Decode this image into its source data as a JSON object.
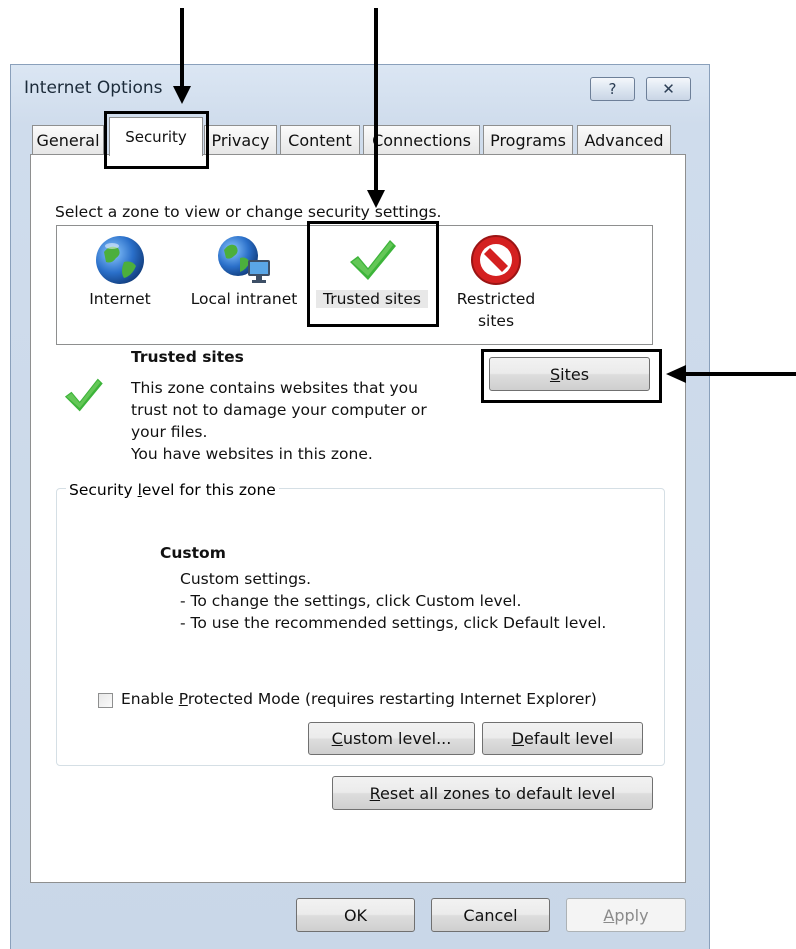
{
  "dialog": {
    "title": "Internet Options",
    "help_glyph": "?",
    "close_glyph": "✕"
  },
  "tabs": [
    "General",
    "Security",
    "Privacy",
    "Content",
    "Connections",
    "Programs",
    "Advanced"
  ],
  "security": {
    "zone_prompt": "Select a zone to view or change security settings.",
    "zones": [
      {
        "label": "Internet",
        "icon": "globe-icon"
      },
      {
        "label": "Local intranet",
        "icon": "globe-network-icon"
      },
      {
        "label": "Trusted sites",
        "icon": "checkmark-icon"
      },
      {
        "label_line1": "Restricted",
        "label_line2": "sites",
        "icon": "no-entry-icon"
      }
    ],
    "selected_zone": {
      "title": "Trusted sites",
      "desc1": "This zone contains websites that you",
      "desc2": "trust not to damage your computer or",
      "desc3": "your files.",
      "desc4": "You have websites in this zone."
    },
    "sites_button": {
      "mnemonic": "S",
      "rest": "ites"
    },
    "level_group": {
      "pre": "Security ",
      "mnemonic": "l",
      "post": "evel for this zone"
    },
    "custom": {
      "title": "Custom",
      "line1": "Custom settings.",
      "line2": "- To change the settings, click Custom level.",
      "line3": "- To use the recommended settings, click Default level."
    },
    "protected_mode": {
      "pre": "Enable ",
      "mnemonic": "P",
      "post": "rotected Mode (requires restarting Internet Explorer)",
      "checked": false
    },
    "custom_level_button": {
      "mnemonic": "C",
      "rest": "ustom level..."
    },
    "default_level_button": {
      "mnemonic": "D",
      "rest": "efault level"
    },
    "reset_button": {
      "mnemonic": "R",
      "rest": "eset all zones to default level"
    }
  },
  "footer": {
    "ok": "OK",
    "cancel": "Cancel",
    "apply": {
      "mnemonic": "A",
      "rest": "pply"
    }
  },
  "colors": {
    "check_green": "#3db43a",
    "no_entry_red": "#d42020",
    "globe_blue": "#2a6fc9",
    "globe_green": "#4caf3c"
  }
}
